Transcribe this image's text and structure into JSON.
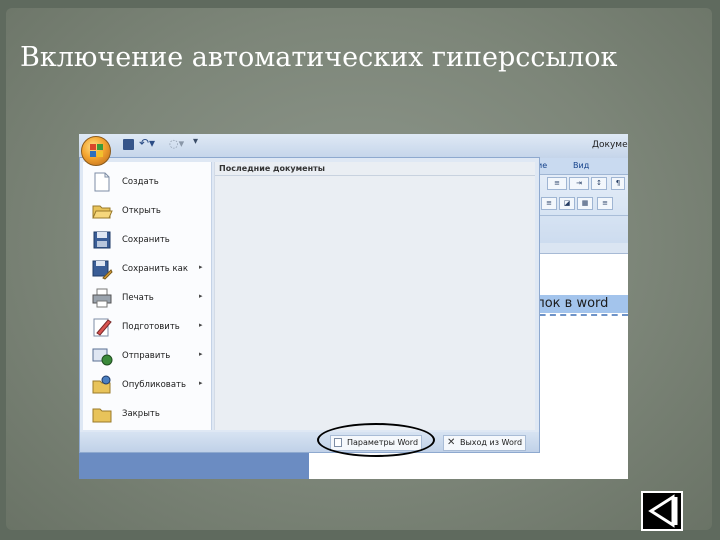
{
  "slide": {
    "title": "Включение автоматических гиперссылок"
  },
  "word_window": {
    "title": "Документ...",
    "tabs": [
      "ие",
      "Вид"
    ],
    "document_text": "сылок в word"
  },
  "office_menu": {
    "items": [
      {
        "label": "Создать",
        "icon": "new-document-icon",
        "submenu": false
      },
      {
        "label": "Открыть",
        "icon": "open-folder-icon",
        "submenu": false
      },
      {
        "label": "Сохранить",
        "icon": "save-disk-icon",
        "submenu": false
      },
      {
        "label": "Сохранить как",
        "icon": "save-as-icon",
        "submenu": true
      },
      {
        "label": "Печать",
        "icon": "printer-icon",
        "submenu": true
      },
      {
        "label": "Подготовить",
        "icon": "prepare-pencil-icon",
        "submenu": true
      },
      {
        "label": "Отправить",
        "icon": "send-icon",
        "submenu": true
      },
      {
        "label": "Опубликовать",
        "icon": "publish-folder-icon",
        "submenu": true
      },
      {
        "label": "Закрыть",
        "icon": "close-folder-icon",
        "submenu": false
      }
    ],
    "recent_title": "Последние документы",
    "options_label": "Параметры Word",
    "exit_label": "Выход из Word"
  },
  "colors": {
    "slide_bg": "#7d8679",
    "highlight_oval": "#000000",
    "office_button": "#f4a530"
  }
}
